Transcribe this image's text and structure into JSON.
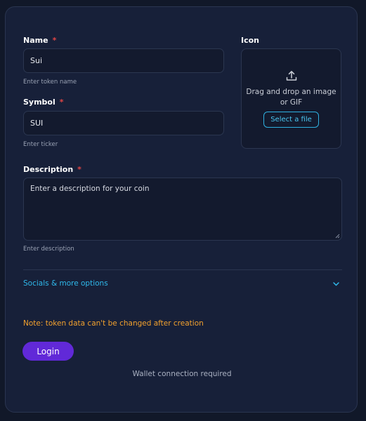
{
  "form": {
    "name": {
      "label": "Name",
      "required_mark": "*",
      "value": "Sui",
      "hint": "Enter token name"
    },
    "symbol": {
      "label": "Symbol",
      "required_mark": "*",
      "value": "SUI",
      "hint": "Enter ticker"
    },
    "icon": {
      "label": "Icon",
      "icon_name": "upload-icon",
      "drop_line1": "Drag and drop an image",
      "drop_line2": "or GIF",
      "select_button": "Select a file"
    },
    "description": {
      "label": "Description",
      "required_mark": "*",
      "placeholder": "Enter a description for your coin",
      "hint": "Enter description"
    },
    "socials": {
      "label": "Socials & more options",
      "icon_name": "chevron-down-icon"
    },
    "note": "Note: token data can't be changed after creation",
    "login_button": "Login",
    "wallet_text": "Wallet connection required"
  },
  "colors": {
    "background": "#111829",
    "card": "#172039",
    "accent_cyan": "#2fb8ea",
    "warning": "#f2a12e",
    "primary_button": "#6129d8",
    "required": "#e04545"
  }
}
